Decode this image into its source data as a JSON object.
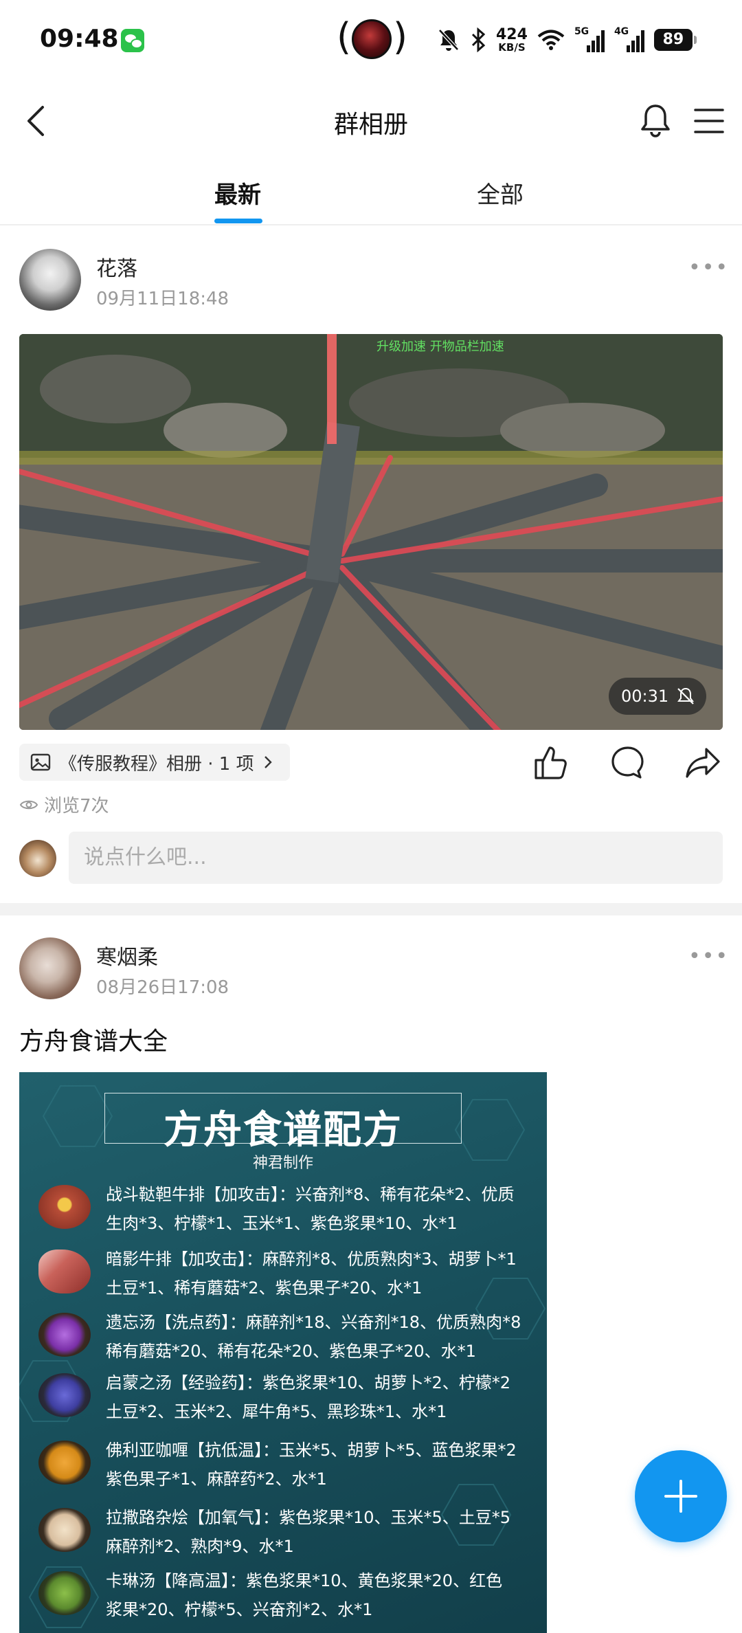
{
  "status_bar": {
    "time": "09:48",
    "net_speed_value": "424",
    "net_speed_unit": "KB/S",
    "signal_1": "5G",
    "signal_2": "4G",
    "battery": "89"
  },
  "header": {
    "title": "群相册",
    "icons": [
      "back-icon",
      "bell-icon",
      "menu-icon"
    ]
  },
  "tabs": [
    {
      "label": "最新",
      "active": true
    },
    {
      "label": "全部",
      "active": false
    }
  ],
  "posts": [
    {
      "author": "花落",
      "time": "09月11日18:48",
      "video": {
        "duration": "00:31",
        "overlay_text": "升级加速 开物品栏加速"
      },
      "album": "《传服教程》相册 · 1 项",
      "views": "浏览7次",
      "comment_placeholder": "说点什么吧..."
    },
    {
      "author": "寒烟柔",
      "time": "08月26日17:08",
      "text": "方舟食谱大全",
      "image": {
        "title": "方舟食谱配方",
        "subtitle": "神君制作",
        "items": [
          {
            "line1": "战斗鞑靼牛排【加攻击】：兴奋剂*8、稀有花朵*2、优质",
            "line2": "生肉*3、柠檬*1、玉米*1、紫色浆果*10、水*1",
            "color": "#a84532"
          },
          {
            "line1": "暗影牛排【加攻击】：麻醉剂*8、优质熟肉*3、胡萝卜*1",
            "line2": "土豆*1、稀有蘑菇*2、紫色果子*20、水*1",
            "color": "#c9625a"
          },
          {
            "line1": "遗忘汤【洗点药】：麻醉剂*18、兴奋剂*18、优质熟肉*8",
            "line2": "稀有蘑菇*20、稀有花朵*20、紫色果子*20、水*1",
            "color": "#7a2fa8"
          },
          {
            "line1": "启蒙之汤【经验药】：紫色浆果*10、胡萝卜*2、柠檬*2",
            "line2": "土豆*2、玉米*2、犀牛角*5、黑珍珠*1、水*1",
            "color": "#3e3ea0"
          },
          {
            "line1": "佛利亚咖喱【抗低温】：玉米*5、胡萝卜*5、蓝色浆果*2",
            "line2": "紫色果子*1、麻醉药*2、水*1",
            "color": "#d58a18"
          },
          {
            "line1": "拉撒路杂烩【加氧气】：紫色浆果*10、玉米*5、土豆*5",
            "line2": "麻醉剂*2、熟肉*9、水*1",
            "color": "#d9bfa0"
          },
          {
            "line1": "卡琳汤【降高温】：紫色浆果*10、黄色浆果*20、红色",
            "line2": "浆果*20、柠檬*5、兴奋剂*2、水*1",
            "color": "#5b8a2e"
          }
        ]
      }
    }
  ]
}
